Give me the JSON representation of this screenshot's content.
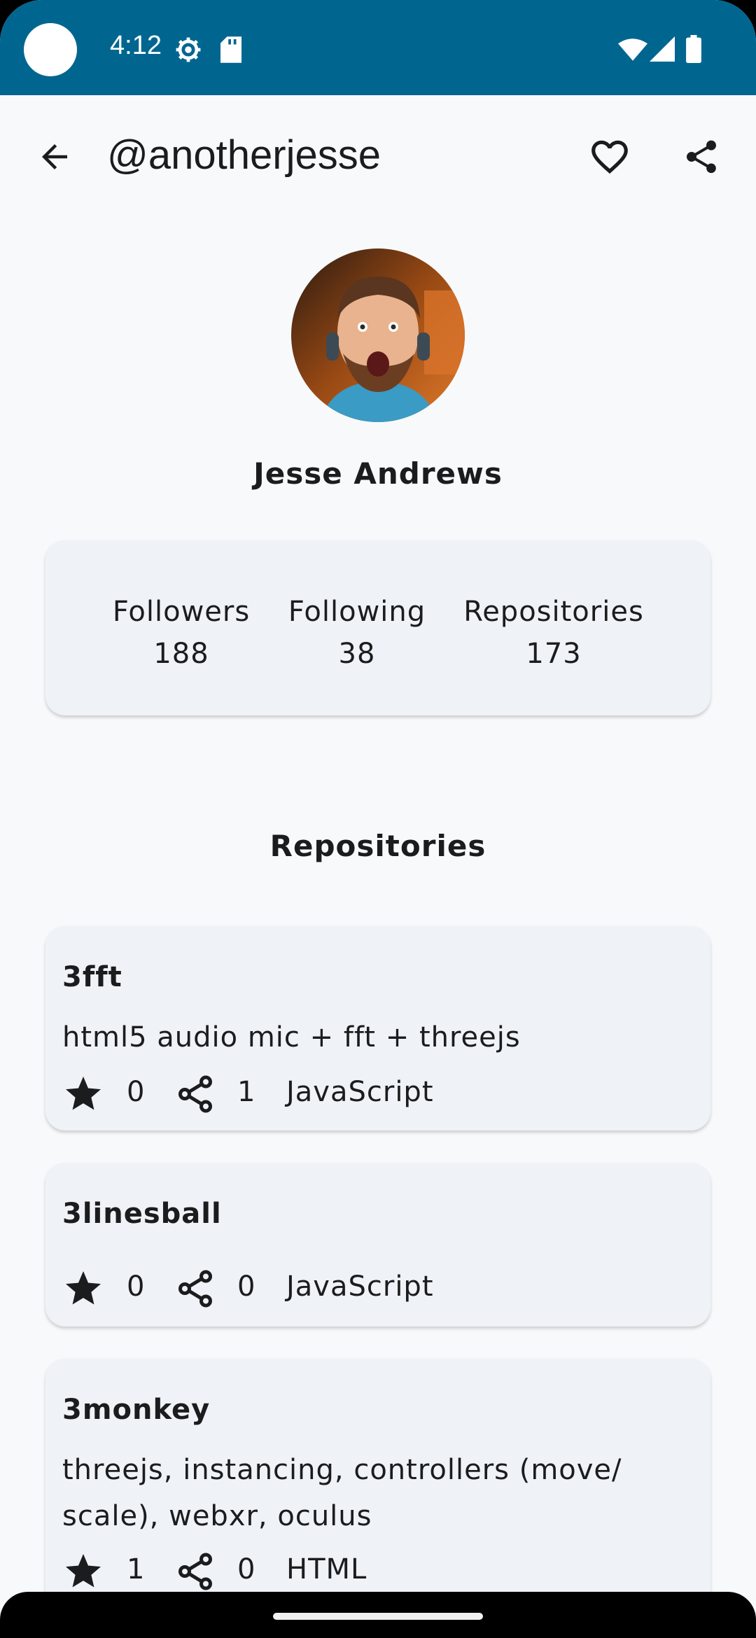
{
  "status_bar": {
    "time": "4:12"
  },
  "app_bar": {
    "title": "@anotherjesse",
    "back_icon": "arrow-back-icon",
    "favorite_icon": "heart-outline-icon",
    "share_icon": "share-icon"
  },
  "profile": {
    "name": "Jesse Andrews"
  },
  "stats": {
    "followers_label": "Followers",
    "followers_value": "188",
    "following_label": "Following",
    "following_value": "38",
    "repositories_label": "Repositories",
    "repositories_value": "173"
  },
  "repositories_title": "Repositories",
  "repos": [
    {
      "name": "3fft",
      "description": "html5 audio mic + fft + threejs",
      "stars": "0",
      "forks": "1",
      "language": "JavaScript"
    },
    {
      "name": "3linesball",
      "description": "",
      "stars": "0",
      "forks": "0",
      "language": "JavaScript"
    },
    {
      "name": "3monkey",
      "description_line1": "threejs, instancing, controllers (move/",
      "description_line2": "scale), webxr, oculus",
      "stars": "1",
      "forks": "0",
      "language": "HTML"
    }
  ],
  "colors": {
    "status_bar": "#006690",
    "background": "#f8f9fb",
    "card": "#eff2f6",
    "text": "#1a1c1e"
  }
}
